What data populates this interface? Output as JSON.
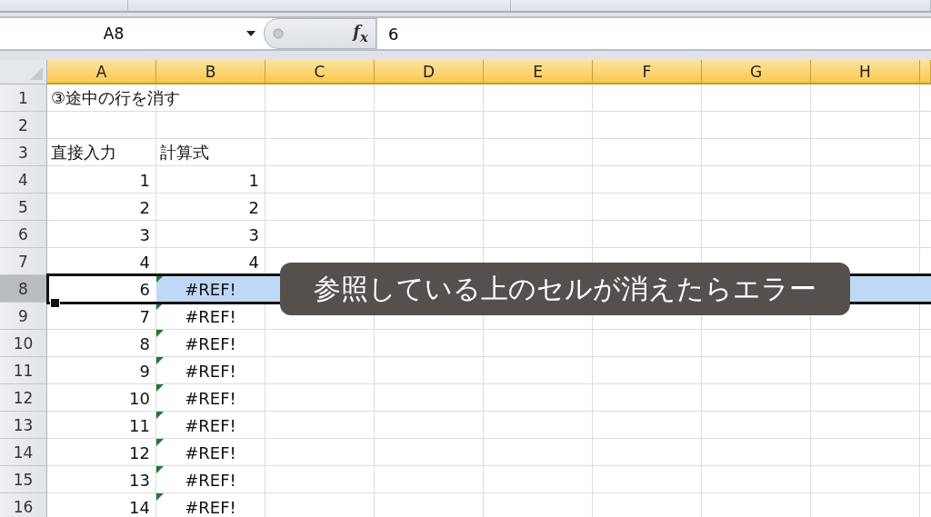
{
  "name_box": "A8",
  "fx_label": "f$_{x}$",
  "formula": "6",
  "columns": [
    {
      "label": "A",
      "selected": true
    },
    {
      "label": "B",
      "selected": true
    },
    {
      "label": "C",
      "selected": true
    },
    {
      "label": "D",
      "selected": true
    },
    {
      "label": "E",
      "selected": true
    },
    {
      "label": "F",
      "selected": true
    },
    {
      "label": "G",
      "selected": true
    },
    {
      "label": "H",
      "selected": true
    }
  ],
  "rows": [
    {
      "num": "1",
      "selected": false,
      "a": {
        "text": "③途中の行を消す",
        "kind": "text"
      }
    },
    {
      "num": "2",
      "selected": false
    },
    {
      "num": "3",
      "selected": false,
      "a": {
        "text": "直接入力",
        "kind": "text"
      },
      "b": {
        "text": "計算式",
        "kind": "text"
      }
    },
    {
      "num": "4",
      "selected": false,
      "a": {
        "text": "1",
        "kind": "number"
      },
      "b": {
        "text": "1",
        "kind": "number"
      }
    },
    {
      "num": "5",
      "selected": false,
      "a": {
        "text": "2",
        "kind": "number"
      },
      "b": {
        "text": "2",
        "kind": "number"
      }
    },
    {
      "num": "6",
      "selected": false,
      "a": {
        "text": "3",
        "kind": "number"
      },
      "b": {
        "text": "3",
        "kind": "number"
      }
    },
    {
      "num": "7",
      "selected": false,
      "a": {
        "text": "4",
        "kind": "number"
      },
      "b": {
        "text": "4",
        "kind": "number"
      }
    },
    {
      "num": "8",
      "selected": true,
      "a": {
        "text": "6",
        "kind": "number"
      },
      "b": {
        "text": "#REF!",
        "kind": "error"
      }
    },
    {
      "num": "9",
      "selected": false,
      "a": {
        "text": "7",
        "kind": "number"
      },
      "b": {
        "text": "#REF!",
        "kind": "error"
      }
    },
    {
      "num": "10",
      "selected": false,
      "a": {
        "text": "8",
        "kind": "number"
      },
      "b": {
        "text": "#REF!",
        "kind": "error"
      }
    },
    {
      "num": "11",
      "selected": false,
      "a": {
        "text": "9",
        "kind": "number"
      },
      "b": {
        "text": "#REF!",
        "kind": "error"
      }
    },
    {
      "num": "12",
      "selected": false,
      "a": {
        "text": "10",
        "kind": "number"
      },
      "b": {
        "text": "#REF!",
        "kind": "error"
      }
    },
    {
      "num": "13",
      "selected": false,
      "a": {
        "text": "11",
        "kind": "number"
      },
      "b": {
        "text": "#REF!",
        "kind": "error"
      }
    },
    {
      "num": "14",
      "selected": false,
      "a": {
        "text": "12",
        "kind": "number"
      },
      "b": {
        "text": "#REF!",
        "kind": "error"
      }
    },
    {
      "num": "15",
      "selected": false,
      "a": {
        "text": "13",
        "kind": "number"
      },
      "b": {
        "text": "#REF!",
        "kind": "error"
      }
    },
    {
      "num": "16",
      "selected": false,
      "a": {
        "text": "14",
        "kind": "number"
      },
      "b": {
        "text": "#REF!",
        "kind": "error"
      }
    }
  ],
  "caption": "参照している上のセルが消えたらエラー"
}
